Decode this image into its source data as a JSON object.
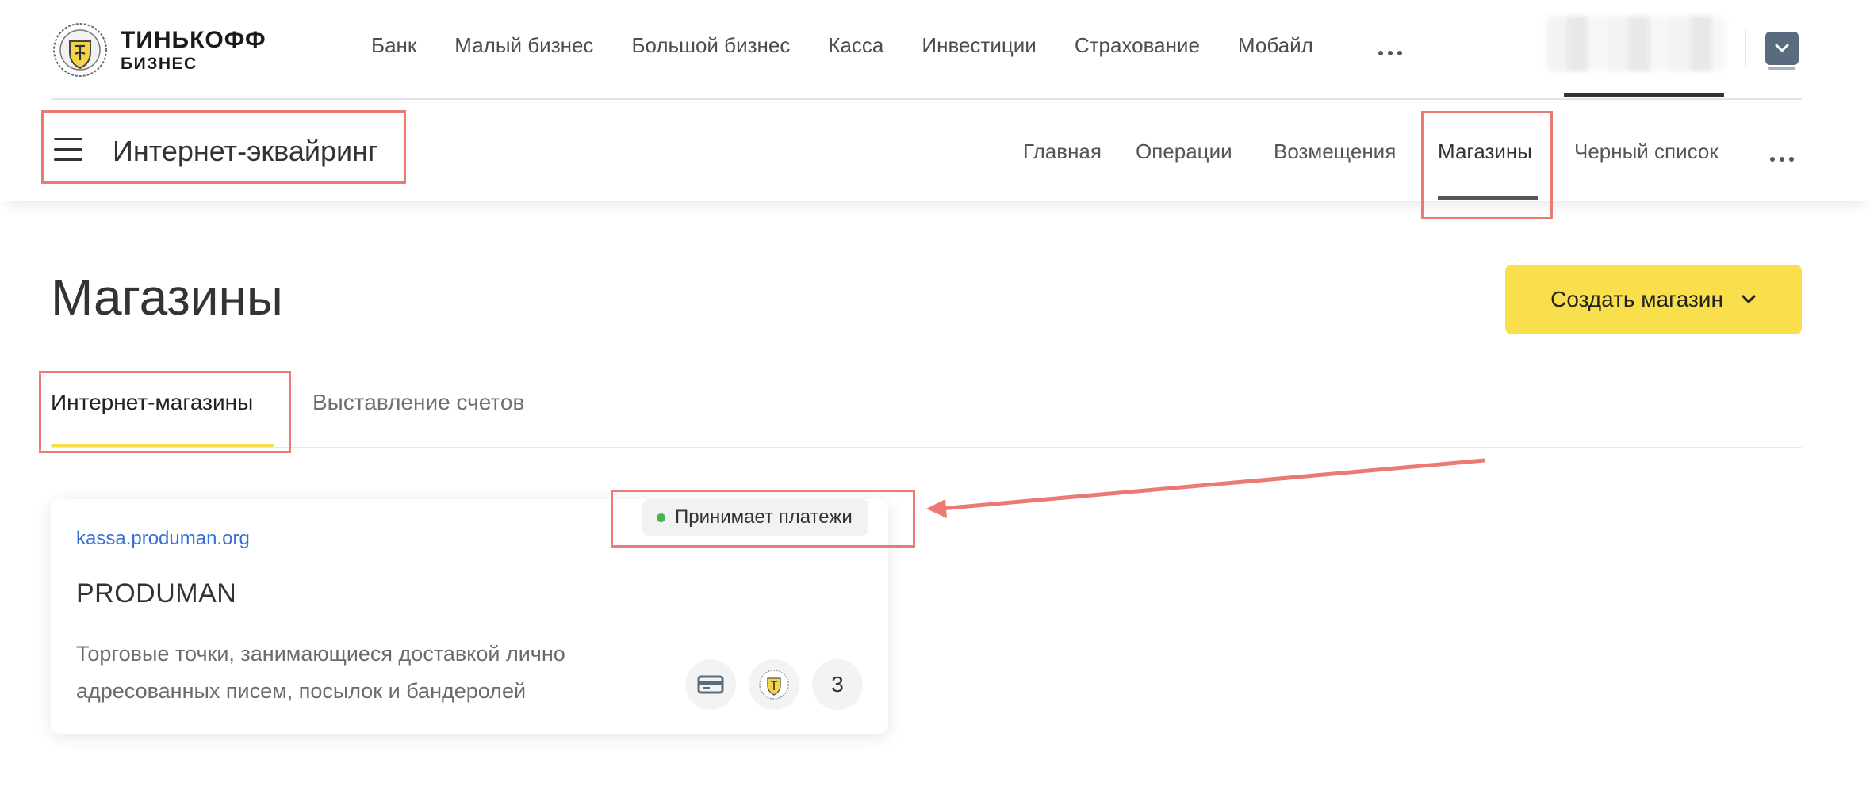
{
  "brand": {
    "line1": "ТИНЬКОФФ",
    "line2": "БИЗНЕС"
  },
  "top_nav": [
    "Банк",
    "Малый бизнес",
    "Большой бизнес",
    "Касса",
    "Инвестиции",
    "Страхование",
    "Мобайл"
  ],
  "section": {
    "title": "Интернет-эквайринг"
  },
  "sub_nav": {
    "items": [
      "Главная",
      "Операции",
      "Возмещения",
      "Магазины",
      "Черный список"
    ],
    "active": "Магазины"
  },
  "page": {
    "title": "Магазины",
    "create_button": "Создать магазин"
  },
  "tabs": {
    "active": "Интернет-магазины",
    "inactive": "Выставление счетов"
  },
  "store_card": {
    "link": "kassa.produman.org",
    "name": "PRODUMAN",
    "description": "Торговые точки, занимающиеся доставкой лично адресованных писем, посылок и бандеролей",
    "status": "Принимает платежи",
    "count": "3"
  },
  "colors": {
    "accent_yellow": "#f9df4c",
    "link_blue": "#3a6fd8",
    "status_green": "#4caf50",
    "annotation_red": "#eb7a73"
  },
  "icons": {
    "menu": "hamburger-icon",
    "more": "more-dots-icon",
    "card": "credit-card-icon",
    "logo": "tinkoff-emblem-icon",
    "dropdown": "chevron-down-icon"
  }
}
